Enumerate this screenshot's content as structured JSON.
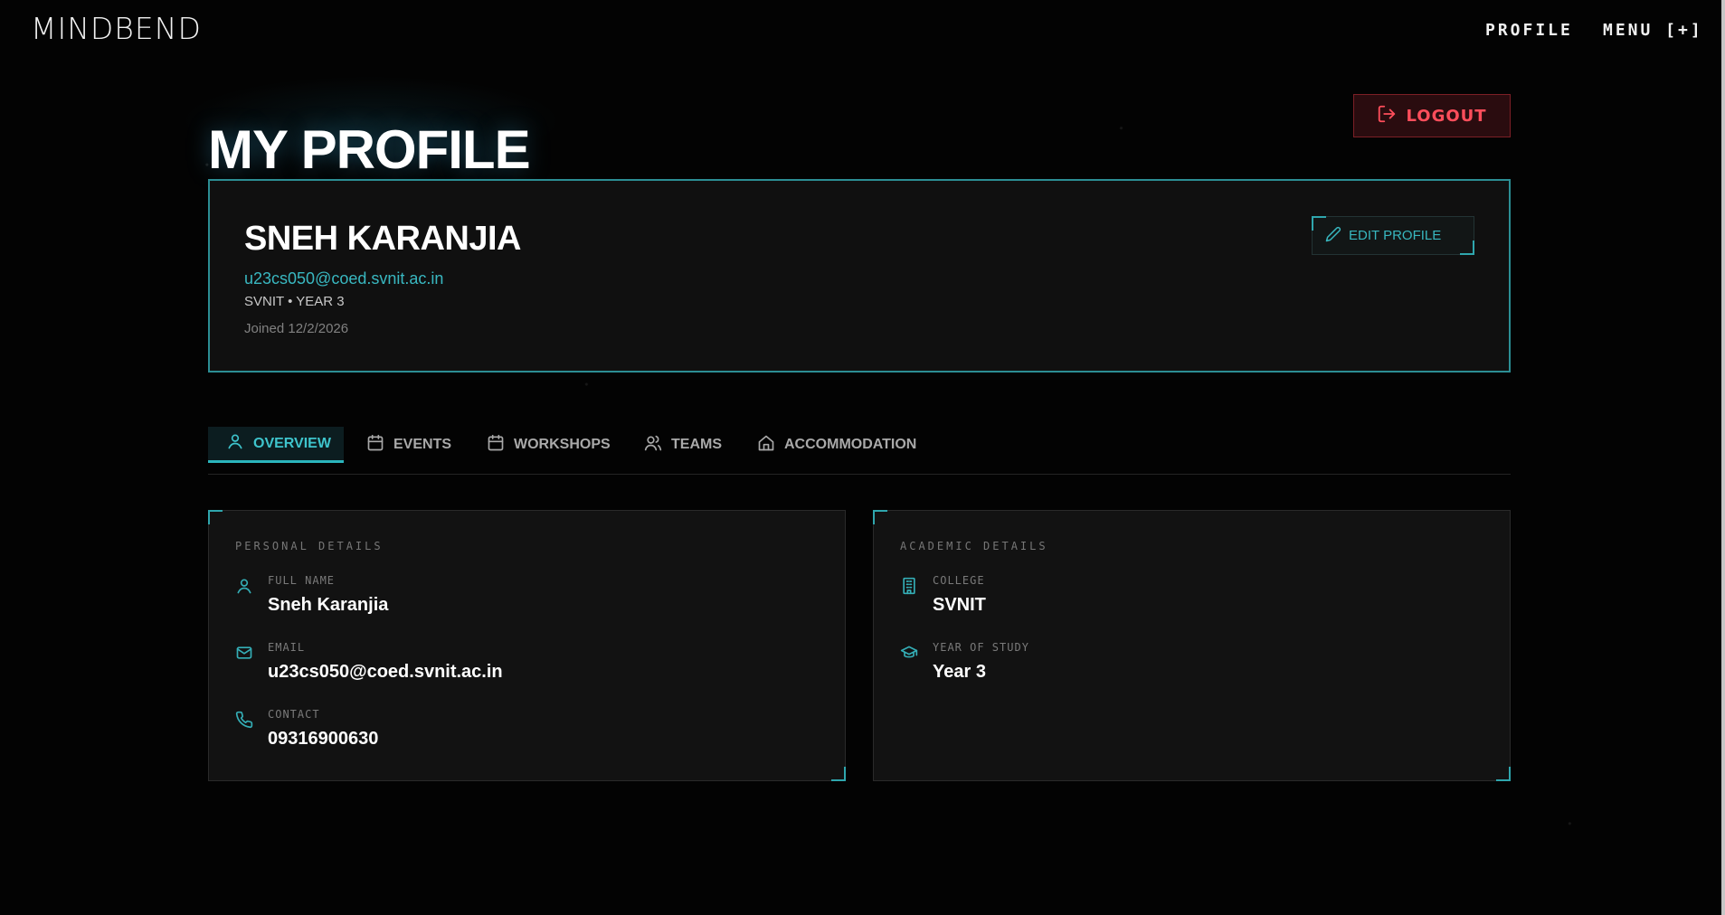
{
  "topnav": {
    "logo": "MINDBEND",
    "profile_link": "PROFILE",
    "menu_link": "MENU [+]"
  },
  "page": {
    "title": "MY PROFILE",
    "logout_label": "LOGOUT"
  },
  "profile": {
    "name": "SNEH KARANJIA",
    "email": "u23cs050@coed.svnit.ac.in",
    "meta": "SVNIT • YEAR 3",
    "joined": "Joined 12/2/2026",
    "edit_label": "EDIT PROFILE"
  },
  "tabs": [
    {
      "label": "OVERVIEW",
      "icon": "user-icon",
      "active": true
    },
    {
      "label": "EVENTS",
      "icon": "calendar-icon",
      "active": false
    },
    {
      "label": "WORKSHOPS",
      "icon": "calendar-icon",
      "active": false
    },
    {
      "label": "TEAMS",
      "icon": "users-icon",
      "active": false
    },
    {
      "label": "ACCOMMODATION",
      "icon": "home-icon",
      "active": false
    }
  ],
  "personal": {
    "section_title": "PERSONAL DETAILS",
    "fields": [
      {
        "label": "FULL NAME",
        "value": "Sneh Karanjia",
        "icon": "user-icon"
      },
      {
        "label": "EMAIL",
        "value": "u23cs050@coed.svnit.ac.in",
        "icon": "mail-icon"
      },
      {
        "label": "CONTACT",
        "value": "09316900630",
        "icon": "phone-icon"
      }
    ]
  },
  "academic": {
    "section_title": "ACADEMIC DETAILS",
    "fields": [
      {
        "label": "COLLEGE",
        "value": "SVNIT",
        "icon": "building-icon"
      },
      {
        "label": "YEAR OF STUDY",
        "value": "Year 3",
        "icon": "graduation-cap-icon"
      }
    ]
  },
  "colors": {
    "accent": "#2ab4bc",
    "danger": "#ff4e5b",
    "background": "#030303",
    "card": "#121212"
  }
}
